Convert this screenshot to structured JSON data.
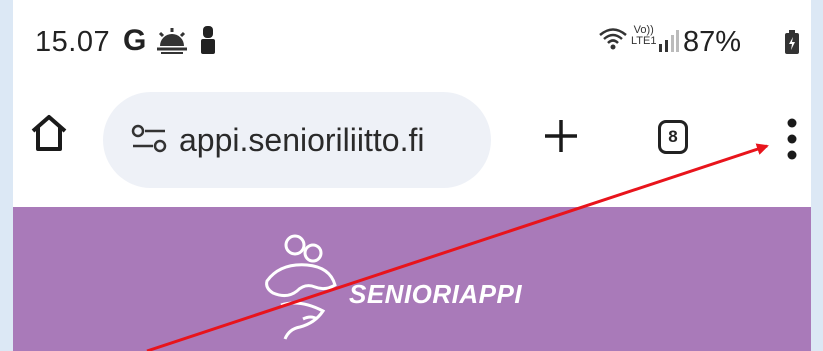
{
  "status_bar": {
    "time": "15.07",
    "g_label": "G",
    "volte_top": "Vo))",
    "volte_bottom": "LTE1",
    "battery": "87%"
  },
  "toolbar": {
    "url": "appi.senioriliitto.fi",
    "tab_count": "8"
  },
  "page": {
    "brand": "SENIORIAPPI"
  },
  "colors": {
    "page_header_bg": "#a97ab9",
    "omnibox_bg": "#eef1f7",
    "annotation_arrow": "#e8141c"
  },
  "icons": [
    "g-icon",
    "weather-icon",
    "person-icon",
    "wifi-icon",
    "signal-icon",
    "battery-icon",
    "home-icon",
    "site-info-icon",
    "new-tab-icon",
    "menu-icon",
    "logo-icon"
  ]
}
